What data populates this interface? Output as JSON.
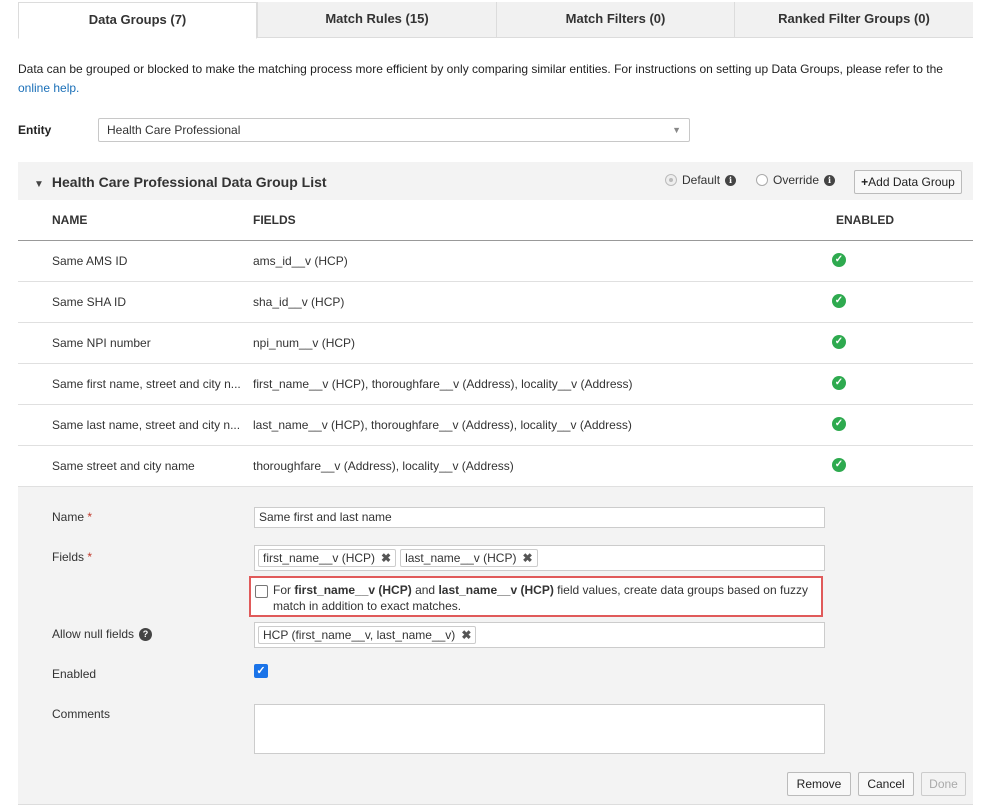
{
  "tabs": [
    {
      "label": "Data Groups (7)",
      "active": true
    },
    {
      "label": "Match Rules (15)"
    },
    {
      "label": "Match Filters (0)"
    },
    {
      "label": "Ranked Filter Groups (0)"
    }
  ],
  "intro": {
    "text": "Data can be grouped or blocked to make the matching process more efficient by only comparing similar entities. For instructions on setting up Data Groups, please refer to the",
    "link": "online help."
  },
  "entity": {
    "label": "Entity",
    "value": "Health Care Professional"
  },
  "panel": {
    "title": "Health Care Professional Data Group List",
    "radio_default": "Default",
    "radio_override": "Override",
    "add_button": "Add Data Group"
  },
  "table": {
    "headers": {
      "name": "NAME",
      "fields": "FIELDS",
      "enabled": "ENABLED"
    },
    "rows": [
      {
        "name": "Same AMS ID",
        "fields": "ams_id__v (HCP)",
        "enabled": true
      },
      {
        "name": "Same SHA ID",
        "fields": "sha_id__v (HCP)",
        "enabled": true
      },
      {
        "name": "Same NPI number",
        "fields": "npi_num__v (HCP)",
        "enabled": true
      },
      {
        "name": "Same first name, street and city n...",
        "fields": "first_name__v (HCP), thoroughfare__v (Address), locality__v (Address)",
        "enabled": true
      },
      {
        "name": "Same last name, street and city n...",
        "fields": "last_name__v (HCP), thoroughfare__v (Address), locality__v (Address)",
        "enabled": true
      },
      {
        "name": "Same street and city name",
        "fields": "thoroughfare__v (Address), locality__v (Address)",
        "enabled": true
      }
    ]
  },
  "form": {
    "name_label": "Name",
    "name_value": "Same first and last name",
    "fields_label": "Fields",
    "field_tags": [
      "first_name__v (HCP)",
      "last_name__v (HCP)"
    ],
    "fuzzy": {
      "pre": "For",
      "field1": "first_name__v (HCP)",
      "mid": "and",
      "field2": "last_name__v (HCP)",
      "post": "field values, create data groups based on fuzzy match in addition to exact matches."
    },
    "allow_null_label": "Allow null fields",
    "null_tags": [
      "HCP (first_name__v, last_name__v)"
    ],
    "enabled_label": "Enabled",
    "comments_label": "Comments",
    "required_mark": "*"
  },
  "buttons": {
    "remove": "Remove",
    "cancel": "Cancel",
    "done": "Done"
  },
  "icons": {
    "enabled": "check-circle-icon",
    "info": "info-icon",
    "help": "help-icon",
    "remove_tag": "close-icon",
    "collapse": "triangle-down-icon",
    "add": "plus-icon"
  },
  "colors": {
    "enabled_check": "#2eaa4f",
    "link": "#1a6fb8",
    "highlight_border": "#e05a5a",
    "checkbox": "#1a73e8"
  }
}
